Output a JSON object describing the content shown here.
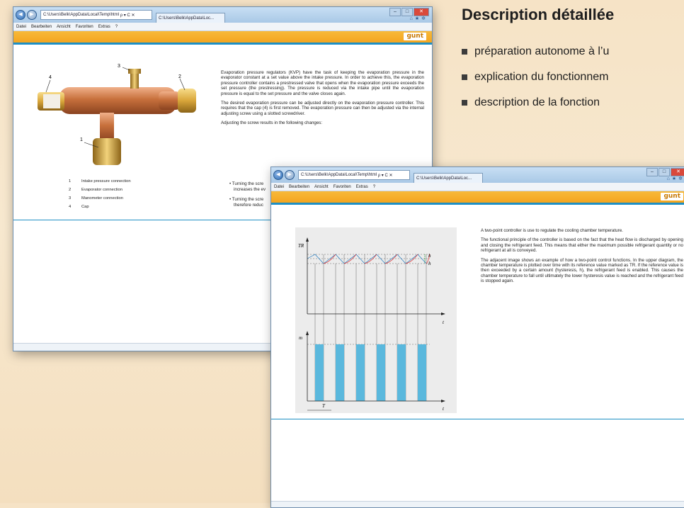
{
  "heading": "Description détaillée",
  "bullets": [
    "préparation autonome à l’u",
    "explication du fonctionnem",
    "description de la fonction"
  ],
  "browser": {
    "address": "C:\\Users\\Belk\\AppData\\Local\\Temp\\html",
    "address_controls": "ρ ▾ C ✕",
    "tab_label": "C:\\Users\\Belk\\AppData\\Loc...",
    "menu": [
      "Datei",
      "Bearbeiten",
      "Ansicht",
      "Favoriten",
      "Extras",
      "?"
    ],
    "logo": "gunt"
  },
  "window1": {
    "paragraphs": [
      "Evaporation pressure regulators (KVP) have the task of keeping the evaporation pressure in the evaporator constant at a set value above the intake pressure. In order to achieve this, the evaporation pressure controller contains a prestressed valve that opens when the evaporation pressure exceeds the set pressure (the prestressing). The pressure is reduced via the intake pipe until the evaporation pressure is equal to the set pressure and the valve closes again.",
      "The desired evaporation pressure can be adjusted directly on the evaporation pressure controller. This requires that the cap (4) is first removed. The evaporation pressure can then be adjusted via the internal adjusting screw using a slotted screwdriver.",
      "Adjusting the screw results in the following changes:"
    ],
    "part_labels": [
      "1",
      "2",
      "3",
      "4"
    ],
    "legend": [
      {
        "num": "1",
        "label": "Intake pressure connection"
      },
      {
        "num": "2",
        "label": "Evaporator connection"
      },
      {
        "num": "3",
        "label": "Manometer connection"
      },
      {
        "num": "4",
        "label": "Cap"
      }
    ],
    "changes": [
      "• Turning the scre",
      "increases the ev",
      "• Turning the scre",
      "therefore reduc"
    ]
  },
  "window2": {
    "paragraphs": [
      "A two-point controller is use to regulate the cooling chamber temperature.",
      "The functional principle of the controller is based on the fact that the heat flow is discharged by opening and closing the refrigerant feed. This means that either the maximum possible refrigerant quantity or no refrigerant at all is conveyed.",
      "The adjacent image shows an example of how a two-point control functions. In the upper diagram, the chamber temperature is plotted over time with its reference value marked as TR. If the reference value is then exceeded by a certain amount (hysteresis, h), the refrigerant feed is enabled. This causes the chamber temperature to fall until ultimately the lower hysteresis value is reached and the refrigerant feed is stopped again."
    ],
    "diagram": {
      "y_top": "TR",
      "y_bottom": "m",
      "x_label": "t",
      "h": "h",
      "period": "T"
    }
  },
  "colors": {
    "orange": "#f4a51f",
    "blue": "#1e8fc4",
    "pulse": "#5ab8dd",
    "brass": "#d9a63a",
    "copper": "#c7703c"
  }
}
